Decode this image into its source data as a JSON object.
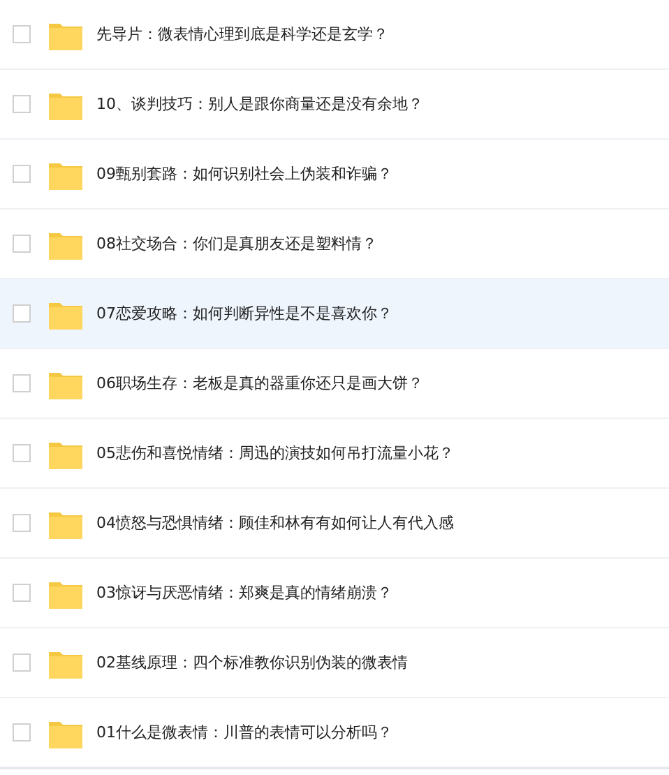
{
  "rows": [
    {
      "name": "先导片：微表情心理到底是科学还是玄学？",
      "selected": false,
      "checked": false
    },
    {
      "name": "10、谈判技巧：别人是跟你商量还是没有余地？",
      "selected": false,
      "checked": false
    },
    {
      "name": "09甄别套路：如何识别社会上伪装和诈骗？",
      "selected": false,
      "checked": false
    },
    {
      "name": "08社交场合：你们是真朋友还是塑料情？",
      "selected": false,
      "checked": false
    },
    {
      "name": "07恋爱攻略：如何判断异性是不是喜欢你？",
      "selected": true,
      "checked": false
    },
    {
      "name": "06职场生存：老板是真的器重你还只是画大饼？",
      "selected": false,
      "checked": false
    },
    {
      "name": "05悲伤和喜悦情绪：周迅的演技如何吊打流量小花？",
      "selected": false,
      "checked": false
    },
    {
      "name": "04愤怒与恐惧情绪：顾佳和林有有如何让人有代入感",
      "selected": false,
      "checked": false
    },
    {
      "name": "03惊讶与厌恶情绪：郑爽是真的情绪崩溃？",
      "selected": false,
      "checked": false
    },
    {
      "name": "02基线原理：四个标准教你识别伪装的微表情",
      "selected": false,
      "checked": false
    },
    {
      "name": "01什么是微表情：川普的表情可以分析吗？",
      "selected": false,
      "checked": false
    }
  ]
}
